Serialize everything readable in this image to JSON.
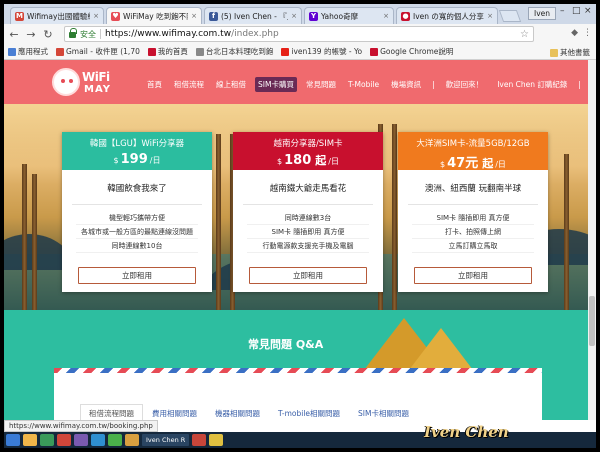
{
  "browser": {
    "tabs": [
      {
        "title": "Wifimay出國體驗組",
        "favicon": "M",
        "favicon_color": "#d44638",
        "active": false
      },
      {
        "title": "WiFiMay 吃到飽不限",
        "favicon": "♥",
        "favicon_color": "#e64b55",
        "active": true
      },
      {
        "title": "(5) Iven Chen - 『上', ",
        "favicon": "f",
        "favicon_color": "#3b5998",
        "active": false
      },
      {
        "title": "Yahoo奇摩",
        "favicon": "Y",
        "favicon_color": "#6001d2",
        "active": false
      },
      {
        "title": "Iven の寬的個人分享",
        "favicon": "●",
        "favicon_color": "#c8102e",
        "active": false
      }
    ],
    "user": "Iven",
    "address": {
      "secure_label": "安全",
      "host": "https://www.wifimay.com.tw",
      "path": "/index.php"
    },
    "bookmarks": [
      {
        "label": "應用程式",
        "color": "#4a7fd4"
      },
      {
        "label": "Gmail - 收件匣 (1,70",
        "color": "#d44638"
      },
      {
        "label": "我的首頁",
        "color": "#c8102e"
      },
      {
        "label": "台北日本料理吃到飽",
        "color": "#888888"
      },
      {
        "label": "iven139 的帳號 - Yo",
        "color": "#e62117"
      },
      {
        "label": "Google Chrome說明",
        "color": "#c8102e"
      }
    ],
    "other_bookmarks": "其他書籤",
    "status_url": "https://www.wifimay.com.tw/booking.php"
  },
  "site": {
    "logo_text_1": "WiFi",
    "logo_text_2": "MAY",
    "nav": [
      {
        "label": "首頁",
        "active": false
      },
      {
        "label": "租借流程",
        "active": false
      },
      {
        "label": "線上租借",
        "active": false
      },
      {
        "label": "SIM卡購買",
        "active": true
      },
      {
        "label": "常見問題",
        "active": false
      },
      {
        "label": "T-Mobile",
        "active": false
      },
      {
        "label": "機場資訊",
        "active": false
      }
    ],
    "nav_user": {
      "sep": "|",
      "welcome": "歡迎回來！",
      "user": "Iven Chen 訂購紀錄",
      "logout": "登出"
    }
  },
  "cards": [
    {
      "title": "韓國【LGU】WiFi分享器",
      "currency": "$",
      "price": "199",
      "unit": "/日",
      "head_color": "#2bbd9f",
      "tagline": "韓國飲食我來了",
      "features": [
        "機型輕巧攜帶方便",
        "各城市或一般方區的最點連線沒問題",
        "同時連線數10台"
      ],
      "button": "立即租用"
    },
    {
      "title": "越南分享器/SIM卡",
      "currency": "$",
      "price": "180",
      "price_suffix": "起",
      "unit": "/日",
      "head_color": "#c8102e",
      "tagline": "越南鐵大爺走馬看花",
      "features": [
        "同時連線數3台",
        "SIM卡 隨插即用 真方便",
        "行動電源款支援充手機及電腦"
      ],
      "button": "立即租用"
    },
    {
      "title": "大洋洲SIM卡-流量5GB/12GB",
      "currency": "$",
      "price": "47元",
      "price_suffix": "起",
      "unit": "/日",
      "head_color": "#f07a1e",
      "tagline": "澳洲、紐西蘭 玩翻南半球",
      "features": [
        "SIM卡 隨插即用 真方便",
        "打卡、拍照傳上網",
        "立馬訂購立馬取"
      ],
      "button": "立即租用"
    }
  ],
  "faq": {
    "title": "常見問題 Q&A",
    "tabs": [
      {
        "label": "租借流程問題",
        "active": true
      },
      {
        "label": "費用相關問題",
        "active": false
      },
      {
        "label": "機器相關問題",
        "active": false
      },
      {
        "label": "T-mobile相關問題",
        "active": false
      },
      {
        "label": "SIM卡相關問題",
        "active": false
      }
    ]
  },
  "taskbar": {
    "apps": [
      "Iven Chen R"
    ]
  },
  "watermark": "Iven Chen"
}
